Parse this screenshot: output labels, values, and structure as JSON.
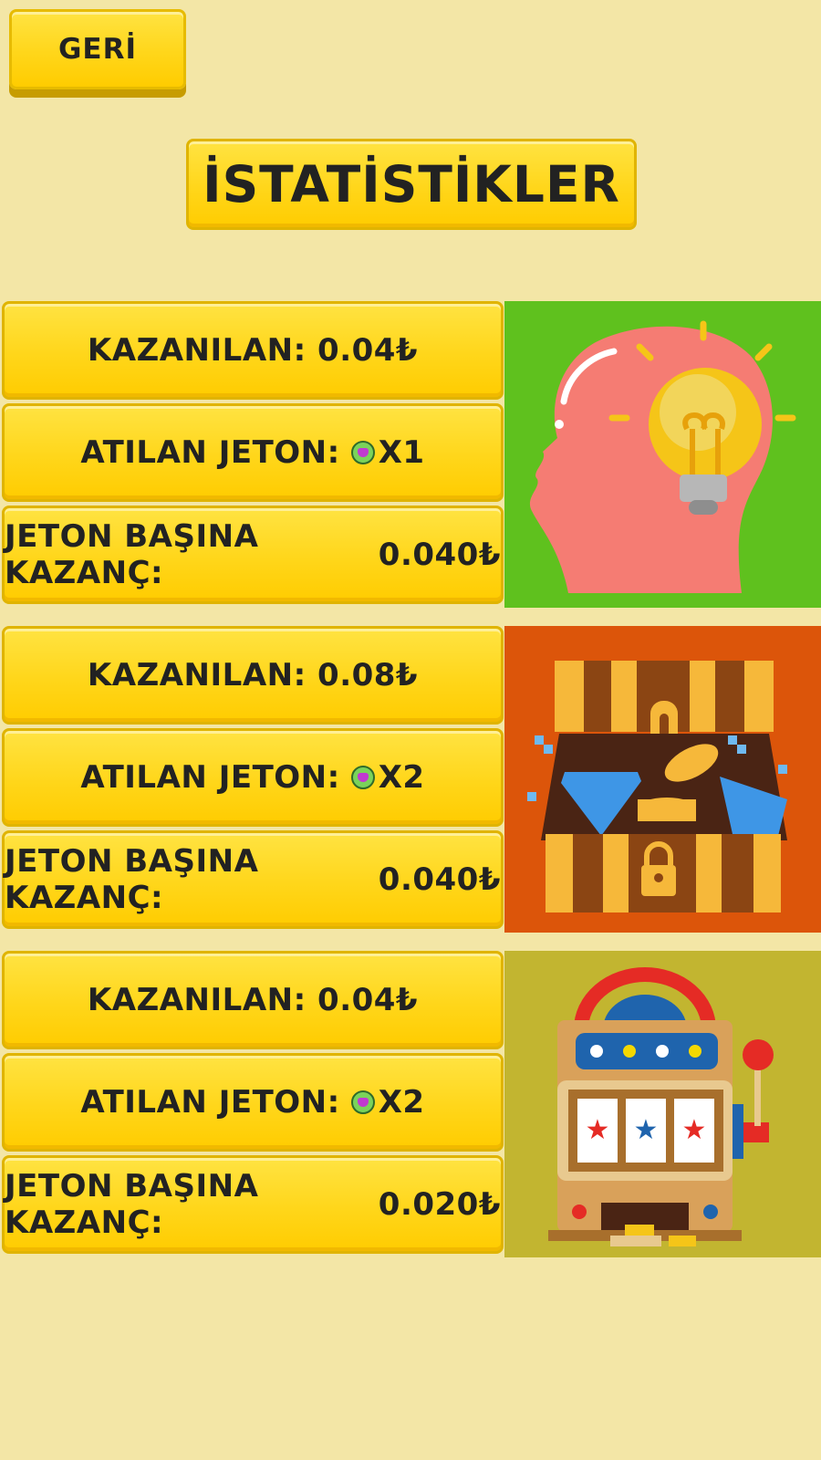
{
  "header": {
    "back_label": "GERİ",
    "title": "İSTATİSTİKLER"
  },
  "groups": [
    {
      "earned_label": "KAZANILAN:",
      "earned_value": "0.04₺",
      "coins_label": "ATILAN JETON:",
      "coins_value": "X1",
      "per_coin_label": "JETON BAŞINA KAZANÇ:",
      "per_coin_value": "0.040₺",
      "image_icon": "brain-idea-icon",
      "panel_color": "#5fc11e"
    },
    {
      "earned_label": "KAZANILAN:",
      "earned_value": "0.08₺",
      "coins_label": "ATILAN JETON:",
      "coins_value": "X2",
      "per_coin_label": "JETON BAŞINA KAZANÇ:",
      "per_coin_value": "0.040₺",
      "image_icon": "treasure-chest-icon",
      "panel_color": "#dc550a"
    },
    {
      "earned_label": "KAZANILAN:",
      "earned_value": "0.04₺",
      "coins_label": "ATILAN JETON:",
      "coins_value": "X2",
      "per_coin_label": "JETON BAŞINA KAZANÇ:",
      "per_coin_value": "0.020₺",
      "image_icon": "slot-machine-icon",
      "panel_color": "#c2b530"
    }
  ],
  "colors": {
    "background": "#f3e6a6",
    "button": "#ffd61a",
    "coin_green": "#7ad35a",
    "coin_heart": "#c03ad0"
  }
}
